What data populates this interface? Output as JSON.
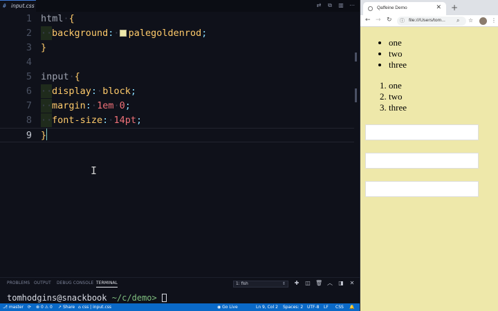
{
  "editor": {
    "tab_label": "input.css",
    "tab_icon": "#",
    "line_numbers": [
      "1",
      "2",
      "3",
      "4",
      "5",
      "6",
      "7",
      "8",
      "9"
    ],
    "code": {
      "l1_selector": "html",
      "l1_brace": "{",
      "l2_prop": "background",
      "l2_value": "palegoldenrod",
      "l3_brace": "}",
      "l5_selector": "input",
      "l5_brace": "{",
      "l6_prop": "display",
      "l6_value": "block",
      "l7_prop": "margin",
      "l7_value1": "1em",
      "l7_value2": "0",
      "l8_prop": "font-size",
      "l8_value": "14pt",
      "l9_brace": "}"
    },
    "swatch_color": "#eee8aa"
  },
  "panel": {
    "tabs": [
      "PROBLEMS",
      "OUTPUT",
      "DEBUG CONSOLE",
      "TERMINAL"
    ],
    "terminal_select": "1: fish",
    "prompt_user": "tomhodgins@snackbook",
    "prompt_path": "~/c/demo>"
  },
  "statusbar": {
    "branch": "master",
    "errors": "0",
    "warnings": "0",
    "share": "Share",
    "breadcrumb": "css | input.css",
    "golive": "Go Live",
    "position": "Ln 9, Col 2",
    "spaces": "Spaces: 2",
    "encoding": "UTF-8",
    "eol": "LF",
    "language": "CSS"
  },
  "browser": {
    "tab_title": "Qaffeine Demo",
    "url": "file:///Users/tom...",
    "ul_items": [
      "one",
      "two",
      "three"
    ],
    "ol_items": [
      "one",
      "two",
      "three"
    ],
    "background": "#eee8aa"
  }
}
